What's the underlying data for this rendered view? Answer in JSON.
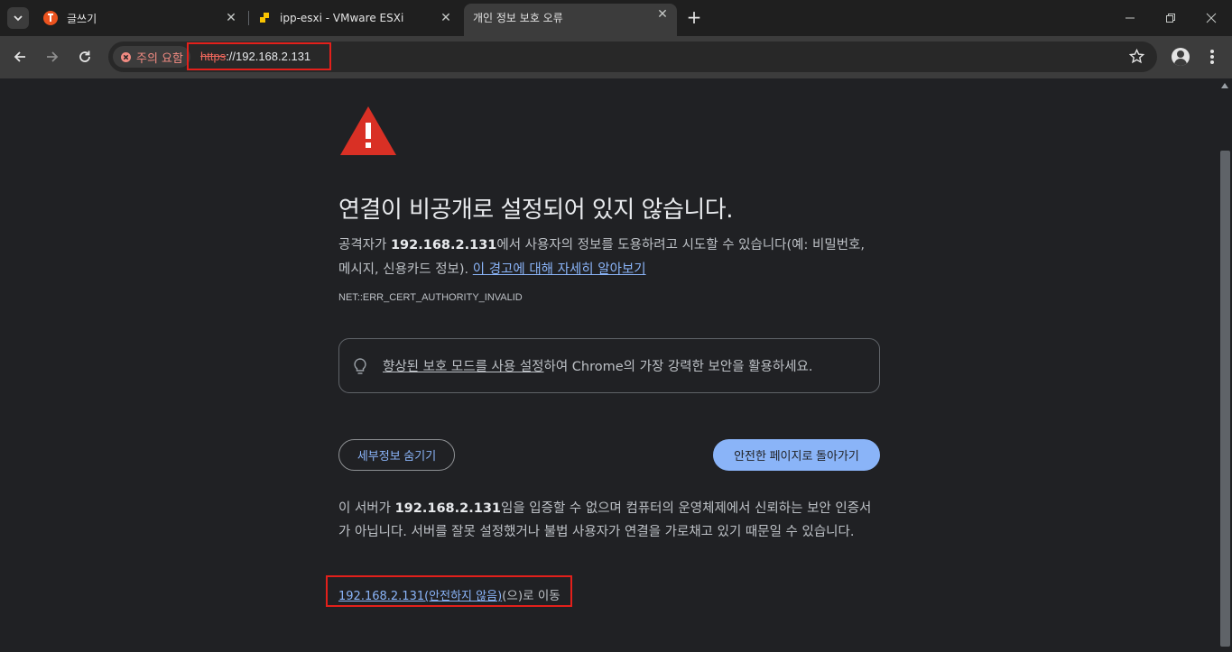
{
  "tabs": [
    {
      "label": "글쓰기",
      "icon": "tistory-icon"
    },
    {
      "label": "ipp-esxi - VMware ESXi",
      "icon": "vmware-icon"
    },
    {
      "label": "개인 정보 보호 오류",
      "active": true
    }
  ],
  "toolbar": {
    "security_chip": "주의 요함",
    "url_scheme": "https",
    "url_rest": "://192.168.2.131"
  },
  "page": {
    "heading": "연결이 비공개로 설정되어 있지 않습니다.",
    "desc_pre": "공격자가 ",
    "desc_host": "192.168.2.131",
    "desc_post": "에서 사용자의 정보를 도용하려고 시도할 수 있습니다(예: 비밀번호, 메시지, 신용카드 정보). ",
    "learn_more": "이 경고에 대해 자세히 알아보기",
    "error_code": "NET::ERR_CERT_AUTHORITY_INVALID",
    "promo_link": "향상된 보호 모드를 사용 설정",
    "promo_rest": "하여 Chrome의 가장 강력한 보안을 활용하세요.",
    "details_button": "세부정보 숨기기",
    "back_button": "안전한 페이지로 돌아가기",
    "details_pre": "이 서버가 ",
    "details_host": "192.168.2.131",
    "details_post": "임을 입증할 수 없으며 컴퓨터의 운영체제에서 신뢰하는 보안 인증서가 아닙니다. 서버를 잘못 설정했거나 불법 사용자가 연결을 가로채고 있기 때문일 수 있습니다.",
    "proceed_link": "192.168.2.131(안전하지 않음)",
    "proceed_suffix": "(으)로 이동"
  },
  "colors": {
    "background": "#202124",
    "accent": "#8ab4f8",
    "warning_red": "#d93025",
    "highlight_box": "#e3201b"
  }
}
